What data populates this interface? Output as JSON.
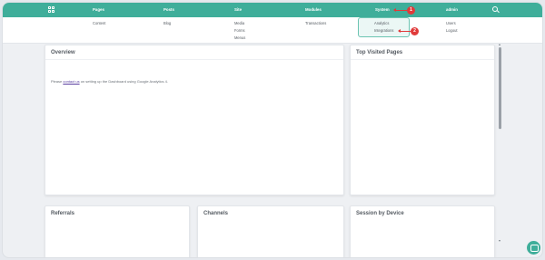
{
  "nav": {
    "pages": "Pages",
    "posts": "Posts",
    "site": "Site",
    "modules": "Modules",
    "system": "System",
    "admin": "admin"
  },
  "dropdown": {
    "pages": [
      "Content"
    ],
    "posts": [
      "Blog"
    ],
    "site": [
      "Media",
      "Forms",
      "Menus"
    ],
    "modules": [
      "Transactions"
    ],
    "system": [
      "Analytics",
      "Integrations"
    ],
    "admin": [
      "Users",
      "Logout"
    ]
  },
  "annotations": {
    "badge1": "1",
    "badge2": "2",
    "color": "#e03a3a"
  },
  "cards": {
    "overview": "Overview",
    "top_visited": "Top Visited Pages",
    "referrals": "Referrals",
    "channels": "Channels",
    "session_device": "Session by Device"
  },
  "overview_message": {
    "prefix": "Please ",
    "link": "contact us",
    "suffix": " on setting up the Dashboard using Google Analytics 4."
  },
  "colors": {
    "accent": "#3fae9a",
    "link": "#5a3fa0"
  },
  "icons": {
    "apps": "grid-icon",
    "search": "search-icon",
    "chat": "chat-icon"
  }
}
